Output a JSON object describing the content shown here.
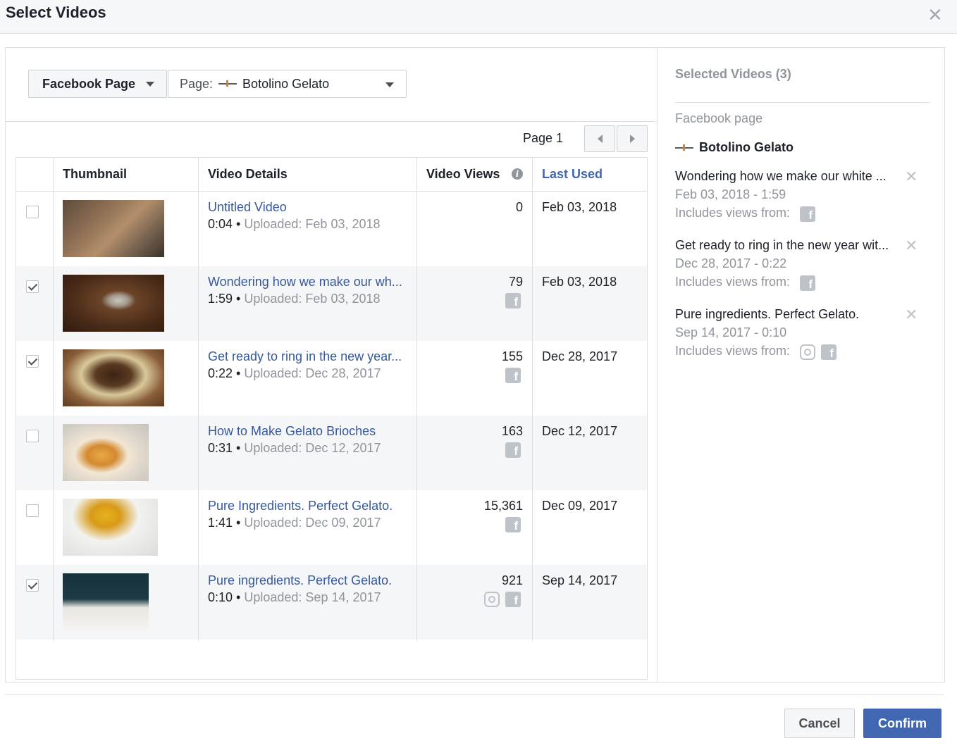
{
  "dialog": {
    "title": "Select Videos",
    "close_icon": "close-icon"
  },
  "filters": {
    "source_type": "Facebook Page",
    "page_prefix": "Page:",
    "page_name": "Botolino Gelato"
  },
  "pager": {
    "label": "Page 1"
  },
  "table": {
    "columns": {
      "thumbnail": "Thumbnail",
      "details": "Video Details",
      "views": "Video Views",
      "last_used": "Last Used"
    },
    "rows": [
      {
        "checked": false,
        "title": "Untitled Video",
        "duration": "0:04",
        "uploaded": "Uploaded: Feb 03, 2018",
        "views": "0",
        "last_used": "Feb 03, 2018",
        "platforms": []
      },
      {
        "checked": true,
        "title": "Wondering how we make our wh...",
        "duration": "1:59",
        "uploaded": "Uploaded: Feb 03, 2018",
        "views": "79",
        "last_used": "Feb 03, 2018",
        "platforms": [
          "facebook"
        ]
      },
      {
        "checked": true,
        "title": "Get ready to ring in the new year...",
        "duration": "0:22",
        "uploaded": "Uploaded: Dec 28, 2017",
        "views": "155",
        "last_used": "Dec 28, 2017",
        "platforms": [
          "facebook"
        ]
      },
      {
        "checked": false,
        "title": "How to Make Gelato Brioches",
        "duration": "0:31",
        "uploaded": "Uploaded: Dec 12, 2017",
        "views": "163",
        "last_used": "Dec 12, 2017",
        "platforms": [
          "facebook"
        ]
      },
      {
        "checked": false,
        "title": "Pure Ingredients. Perfect Gelato.",
        "duration": "1:41",
        "uploaded": "Uploaded: Dec 09, 2017",
        "views": "15,361",
        "last_used": "Dec 09, 2017",
        "platforms": [
          "facebook"
        ]
      },
      {
        "checked": true,
        "title": "Pure ingredients. Perfect Gelato.",
        "duration": "0:10",
        "uploaded": "Uploaded: Sep 14, 2017",
        "views": "921",
        "last_used": "Sep 14, 2017",
        "platforms": [
          "instagram",
          "facebook"
        ]
      }
    ]
  },
  "selected": {
    "title": "Selected Videos (3)",
    "source_label": "Facebook page",
    "page_name": "Botolino Gelato",
    "includes_label": "Includes views from:",
    "items": [
      {
        "name": "Wondering how we make our white ...",
        "sub": "Feb 03, 2018 - 1:59",
        "platforms": [
          "facebook"
        ]
      },
      {
        "name": "Get ready to ring in the new year wit...",
        "sub": "Dec 28, 2017 - 0:22",
        "platforms": [
          "facebook"
        ]
      },
      {
        "name": "Pure ingredients. Perfect Gelato.",
        "sub": "Sep 14, 2017 - 0:10",
        "platforms": [
          "instagram",
          "facebook"
        ]
      }
    ]
  },
  "buttons": {
    "cancel": "Cancel",
    "confirm": "Confirm"
  },
  "colors": {
    "link": "#365899",
    "accent": "#4267b2",
    "muted": "#90949c"
  }
}
